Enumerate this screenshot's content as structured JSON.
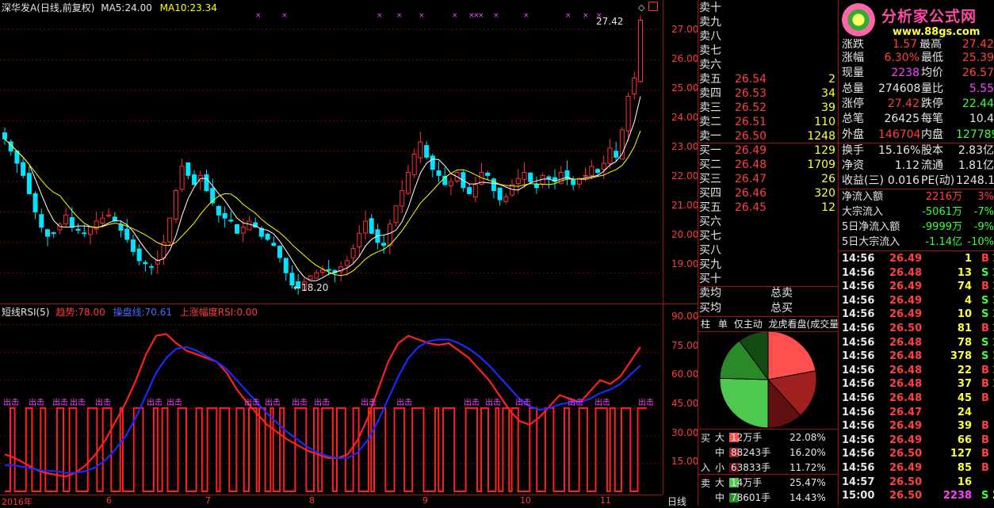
{
  "chart_header": {
    "stock": "深华发A",
    "period": "(日线,前复权)",
    "ma5_label": "MA5:",
    "ma5_value": "24.00",
    "ma10_label": "MA10:",
    "ma10_value": "23.34"
  },
  "rsi_header": {
    "name": "短线RSI(5)",
    "trend_label": "趋势:",
    "trend_value": "78.00",
    "pan_label": "操盘线:",
    "pan_value": "70.61",
    "rise_label": "上涨幅度RSI:",
    "rise_value": "0.00"
  },
  "price_axis": [
    "27.00",
    "26.00",
    "25.00",
    "24.00",
    "23.00",
    "22.00",
    "21.00",
    "20.00",
    "19.00"
  ],
  "rsi_axis": [
    "90.00",
    "75.00",
    "60.00",
    "45.00",
    "30.00",
    "15.00"
  ],
  "date_axis": [
    {
      "label": "2016年"
    },
    {
      "label": "6"
    },
    {
      "label": "7"
    },
    {
      "label": "8"
    },
    {
      "label": "9"
    },
    {
      "label": "10"
    },
    {
      "label": "11"
    }
  ],
  "period_button": "日线",
  "annotations": {
    "high": "27.42",
    "low": "18.20",
    "signal": "出击"
  },
  "chart_data": {
    "type": "candlestick",
    "title": "深华发A (日线,前复权)",
    "ylim": [
      18.2,
      27.6
    ],
    "close": [
      23.4,
      23.0,
      22.6,
      22.2,
      21.6,
      21.0,
      20.5,
      20.2,
      20.3,
      20.6,
      20.9,
      20.5,
      20.4,
      20.3,
      20.5,
      20.7,
      20.8,
      20.9,
      20.7,
      20.4,
      20.1,
      19.7,
      19.4,
      19.3,
      19.2,
      19.4,
      20.0,
      20.8,
      21.7,
      22.5,
      22.2,
      21.9,
      22.2,
      21.7,
      21.3,
      20.9,
      20.8,
      20.7,
      20.3,
      20.5,
      20.7,
      20.5,
      20.2,
      20.1,
      19.9,
      19.5,
      19.0,
      18.6,
      18.5,
      18.7,
      18.9,
      19.0,
      19.1,
      19.1,
      19.0,
      19.2,
      19.4,
      19.8,
      20.3,
      20.7,
      20.3,
      20.0,
      19.9,
      20.6,
      21.2,
      21.7,
      22.3,
      22.9,
      23.3,
      22.8,
      22.4,
      22.2,
      21.9,
      22.0,
      22.3,
      21.8,
      21.6,
      21.9,
      22.3,
      22.2,
      21.7,
      21.4,
      21.5,
      21.9,
      22.1,
      22.3,
      22.0,
      21.8,
      22.2,
      22.1,
      22.0,
      22.3,
      22.1,
      21.9,
      22.1,
      22.2,
      22.5,
      22.3,
      22.6,
      23.1,
      22.8,
      23.7,
      24.8,
      25.4,
      27.3
    ],
    "ma5_label": "MA5",
    "ma10_label": "MA10",
    "rsi": {
      "series": [
        {
          "name": "趋势",
          "values": [
            20,
            18,
            15,
            12,
            10,
            9,
            8,
            10,
            14,
            20,
            28,
            38,
            48,
            60,
            74,
            84,
            85,
            80,
            76,
            74,
            72,
            70,
            64,
            55,
            48,
            42,
            36,
            32,
            28,
            25,
            22,
            20,
            18,
            18,
            20,
            28,
            40,
            55,
            70,
            80,
            84,
            82,
            80,
            79,
            80,
            76,
            72,
            66,
            60,
            52,
            44,
            38,
            36,
            40,
            46,
            52,
            50,
            48,
            54,
            60,
            58,
            62,
            70,
            78
          ]
        },
        {
          "name": "操盘线",
          "values": [
            14,
            14,
            13,
            12,
            11,
            11,
            10,
            10,
            11,
            13,
            17,
            23,
            30,
            40,
            52,
            64,
            72,
            77,
            78,
            76,
            73,
            70,
            66,
            60,
            54,
            48,
            42,
            37,
            32,
            28,
            24,
            21,
            19,
            18,
            18,
            21,
            28,
            38,
            50,
            62,
            72,
            78,
            81,
            82,
            82,
            80,
            77,
            73,
            68,
            62,
            56,
            50,
            46,
            44,
            45,
            47,
            48,
            48,
            50,
            53,
            55,
            58,
            63,
            68
          ]
        }
      ]
    }
  },
  "order_book": {
    "sell": [
      {
        "label": "卖十",
        "price": "",
        "vol": ""
      },
      {
        "label": "卖九",
        "price": "",
        "vol": ""
      },
      {
        "label": "卖八",
        "price": "",
        "vol": ""
      },
      {
        "label": "卖七",
        "price": "",
        "vol": ""
      },
      {
        "label": "卖六",
        "price": "",
        "vol": ""
      },
      {
        "label": "卖五",
        "price": "26.54",
        "vol": "2"
      },
      {
        "label": "卖四",
        "price": "26.53",
        "vol": "34"
      },
      {
        "label": "卖三",
        "price": "26.52",
        "vol": "39"
      },
      {
        "label": "卖二",
        "price": "26.51",
        "vol": "110"
      },
      {
        "label": "卖一",
        "price": "26.50",
        "vol": "1248"
      }
    ],
    "buy": [
      {
        "label": "买一",
        "price": "26.49",
        "vol": "129"
      },
      {
        "label": "买二",
        "price": "26.48",
        "vol": "1709"
      },
      {
        "label": "买三",
        "price": "26.47",
        "vol": "26"
      },
      {
        "label": "买四",
        "price": "26.46",
        "vol": "320"
      },
      {
        "label": "买五",
        "price": "26.45",
        "vol": "12"
      },
      {
        "label": "买六",
        "price": "",
        "vol": ""
      },
      {
        "label": "买七",
        "price": "",
        "vol": ""
      },
      {
        "label": "买八",
        "price": "",
        "vol": ""
      },
      {
        "label": "买九",
        "price": "",
        "vol": ""
      },
      {
        "label": "买十",
        "price": "",
        "vol": ""
      }
    ],
    "avg_sell_label": "卖均",
    "total_sell_label": "总卖",
    "avg_buy_label": "买均",
    "total_buy_label": "总买"
  },
  "tabs": [
    "柱",
    "单",
    "仅主动",
    "龙虎看盘(成交量/笔)"
  ],
  "pie": {
    "slices": [
      {
        "value": 22.08,
        "color": "#ff5050"
      },
      {
        "value": 16.2,
        "color": "#a02020"
      },
      {
        "value": 11.72,
        "color": "#601010"
      },
      {
        "value": 25.47,
        "color": "#4ec84e"
      },
      {
        "value": 14.43,
        "color": "#2a8a2a"
      },
      {
        "value": 10.1,
        "color": "#144a14"
      }
    ]
  },
  "distribution": {
    "buy_label": "买",
    "in_label": "入",
    "sell_label": "卖",
    "rows": [
      {
        "size": "大",
        "color": "#ff5050",
        "amount": "12万手",
        "pct": "22.08%"
      },
      {
        "size": "中",
        "color": "#a02020",
        "amount": "88243手",
        "pct": "16.20%"
      },
      {
        "size": "小",
        "color": "#601010",
        "amount": "63833手",
        "pct": "11.72%"
      },
      {
        "size": "大",
        "color": "#4ec84e",
        "amount": "14万手",
        "pct": "25.47%"
      },
      {
        "size": "中",
        "color": "#2a8a2a",
        "amount": "78601手",
        "pct": "14.43%"
      }
    ]
  },
  "logo": {
    "title": "分析家公式网",
    "url": "www.88gs.com"
  },
  "quote": {
    "partial": [
      {
        "l": "涨跌",
        "v": "1.57"
      },
      {
        "l": "最高",
        "v": "27.42"
      }
    ],
    "rows": [
      {
        "l1": "涨幅",
        "v1": "6.30%",
        "l2": "最低",
        "v2": "25.39"
      },
      {
        "l1": "现量",
        "v1": "2238",
        "l2": "均价",
        "v2": "26.57"
      },
      {
        "l1": "总量",
        "v1": "274608",
        "l2": "量比",
        "v2": "5.55"
      },
      {
        "l1": "涨停",
        "v1": "27.42",
        "l2": "跌停",
        "v2": "22.44"
      },
      {
        "l1": "总笔",
        "v1": "26425",
        "l2": "每笔",
        "v2": "10.4"
      },
      {
        "l1": "外盘",
        "v1": "146704",
        "l2": "内盘",
        "v2": "127789"
      },
      {
        "l1": "换手",
        "v1": "15.16%",
        "l2": "股本",
        "v2": "2.83亿"
      },
      {
        "l1": "净资",
        "v1": "1.12",
        "l2": "流通",
        "v2": "1.81亿"
      },
      {
        "l1": "收益(三)",
        "v1": "0.016",
        "l2": "PE(动)",
        "v2": "1248.1"
      }
    ]
  },
  "fund_flow": [
    {
      "l": "净流入额",
      "v": "2216万",
      "p": "3%"
    },
    {
      "l": "大宗流入",
      "v": "-5061万",
      "p": "-7%"
    },
    {
      "l": "5日净流入额",
      "v": "-9999万",
      "p": "-9%"
    },
    {
      "l": "5日大宗流入",
      "v": "-1.14亿",
      "p": "-10%"
    }
  ],
  "ticks": [
    {
      "t": "14:56",
      "p": "26.49",
      "v": "1",
      "s": "B",
      "x": "1"
    },
    {
      "t": "14:56",
      "p": "26.48",
      "v": "13",
      "s": "S",
      "x": "1"
    },
    {
      "t": "14:56",
      "p": "26.49",
      "v": "74",
      "s": "B",
      "x": "12"
    },
    {
      "t": "14:56",
      "p": "26.49",
      "v": "4",
      "s": "S",
      "x": "1"
    },
    {
      "t": "14:56",
      "p": "26.49",
      "v": "10",
      "s": "S",
      "x": "1"
    },
    {
      "t": "14:56",
      "p": "26.50",
      "v": "81",
      "s": "B",
      "x": "1"
    },
    {
      "t": "14:56",
      "p": "26.48",
      "v": "78",
      "s": "S",
      "x": "1"
    },
    {
      "t": "14:56",
      "p": "26.48",
      "v": "378",
      "s": "S",
      "x": "1"
    },
    {
      "t": "14:56",
      "p": "26.48",
      "v": "22",
      "s": "B",
      "x": "1"
    },
    {
      "t": "14:56",
      "p": "26.48",
      "v": "37",
      "s": "B",
      "x": "1"
    },
    {
      "t": "14:56",
      "p": "26.48",
      "v": "45",
      "s": "B",
      "x": ""
    },
    {
      "t": "14:56",
      "p": "26.47",
      "v": "24",
      "s": "",
      "x": ""
    },
    {
      "t": "14:56",
      "p": "26.49",
      "v": "39",
      "s": "B",
      "x": ""
    },
    {
      "t": "14:56",
      "p": "26.49",
      "v": "66",
      "s": "B",
      "x": ""
    },
    {
      "t": "14:56",
      "p": "26.50",
      "v": "127",
      "s": "B",
      "x": ""
    },
    {
      "t": "14:56",
      "p": "26.49",
      "v": "85",
      "s": "B",
      "x": ""
    },
    {
      "t": "14:57",
      "p": "26.50",
      "v": "16",
      "s": "",
      "x": ""
    },
    {
      "t": "15:00",
      "p": "26.50",
      "v": "2238",
      "s": "S",
      "x": "257"
    }
  ]
}
